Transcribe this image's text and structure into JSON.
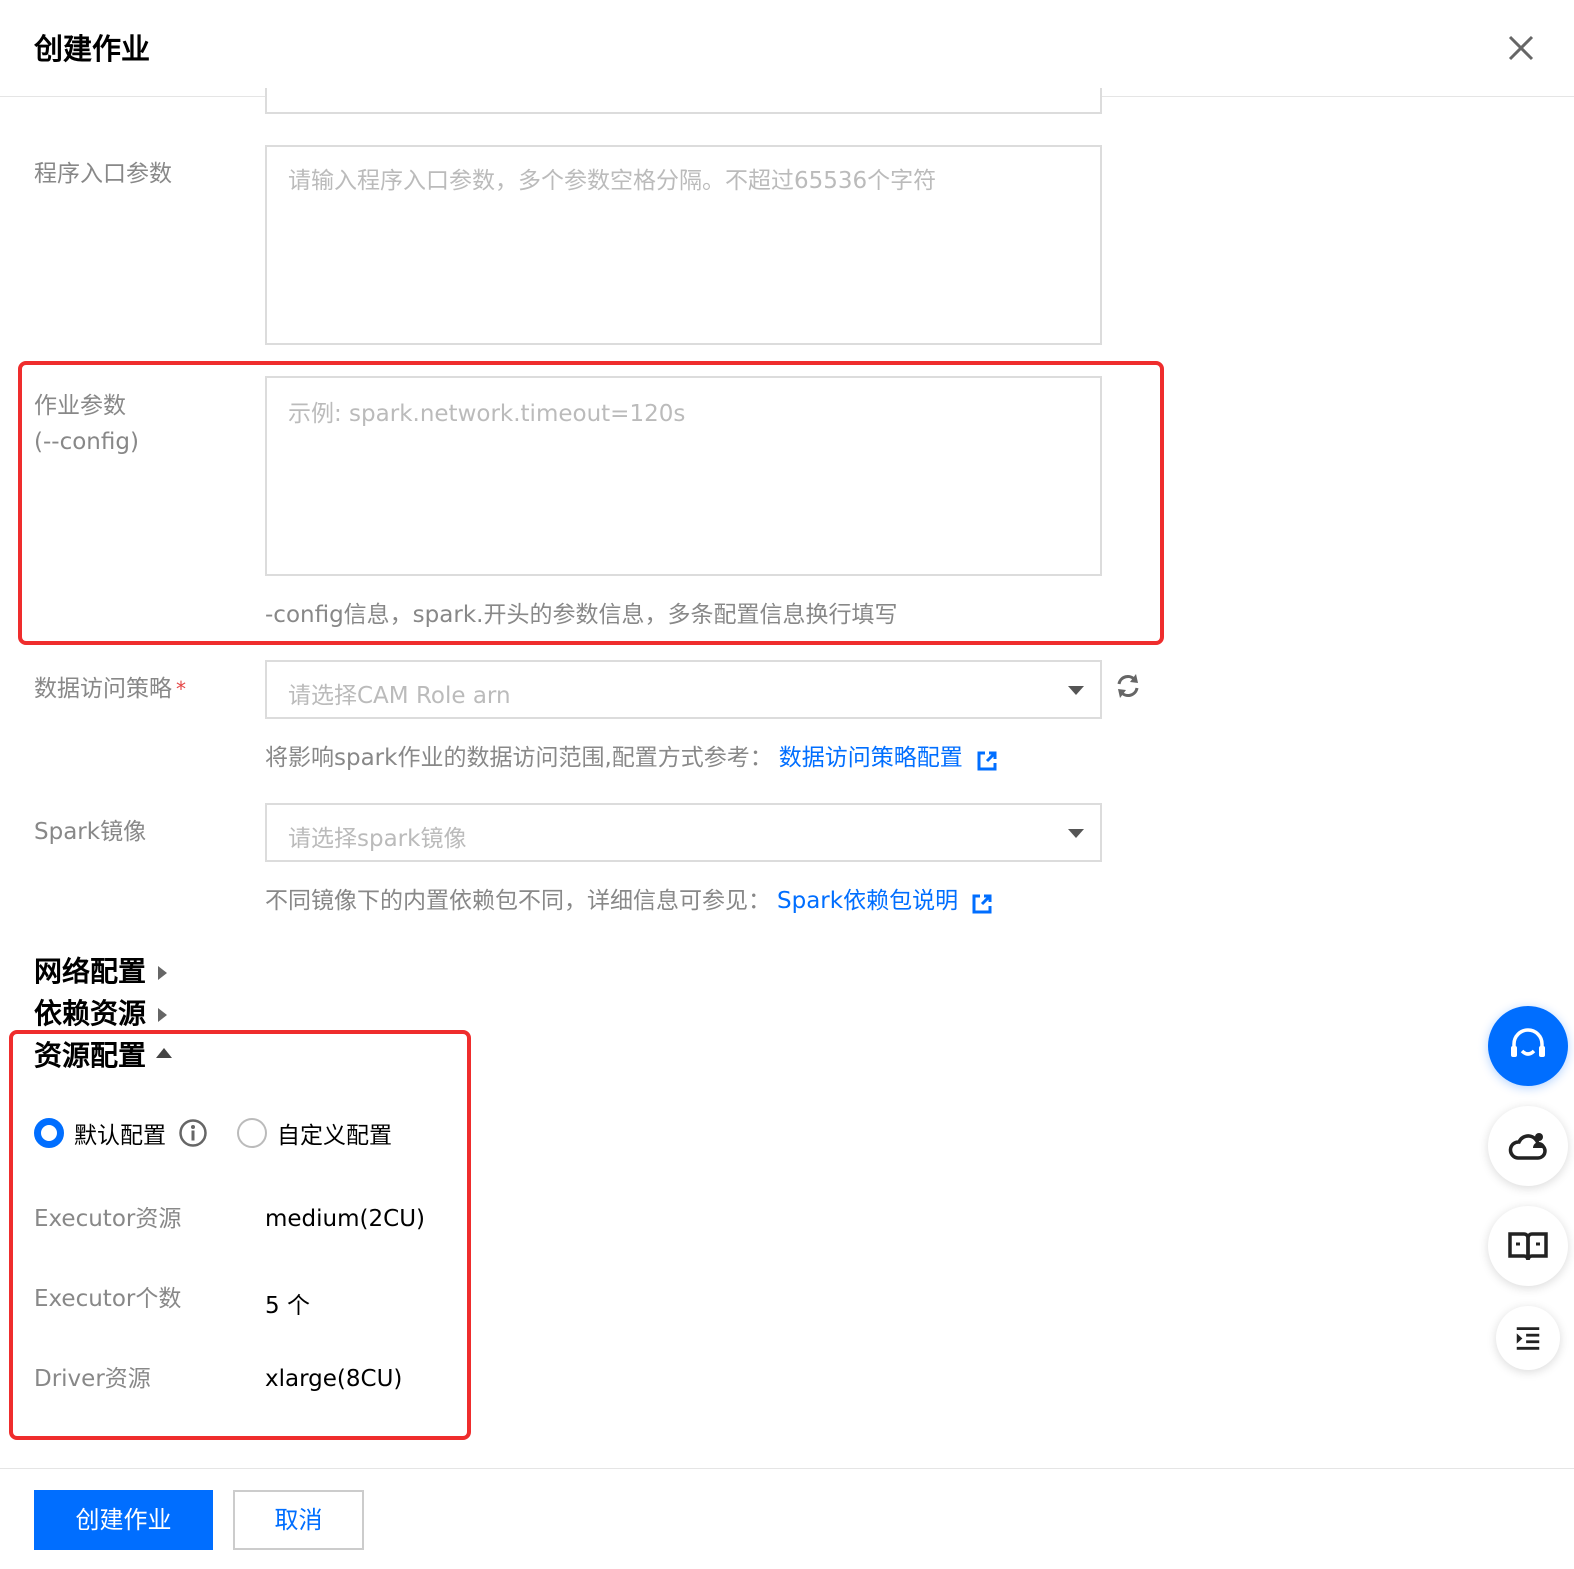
{
  "dialog": {
    "title": "创建作业",
    "close_icon": "close-icon"
  },
  "entry_params": {
    "label": "程序入口参数",
    "placeholder": "请输入程序入口参数，多个参数空格分隔。不超过65536个字符"
  },
  "job_params": {
    "label_line1": "作业参数",
    "label_line2": "(--config)",
    "placeholder": "示例: spark.network.timeout=120s",
    "hint": "-config信息，spark.开头的参数信息，多条配置信息换行填写"
  },
  "data_access": {
    "label": "数据访问策略",
    "required_mark": "*",
    "placeholder": "请选择CAM Role arn",
    "hint": "将影响spark作业的数据访问范围,配置方式参考：",
    "link": "数据访问策略配置"
  },
  "spark_image": {
    "label": "Spark镜像",
    "placeholder": "请选择spark镜像",
    "hint": "不同镜像下的内置依赖包不同，详细信息可参见：",
    "link": "Spark依赖包说明"
  },
  "sections": {
    "network": "网络配置",
    "dependencies": "依赖资源",
    "resources": "资源配置"
  },
  "resource_config": {
    "option_default": "默认配置",
    "option_custom": "自定义配置",
    "selected": "默认配置",
    "rows": [
      {
        "label": "Executor资源",
        "value": "medium(2CU)"
      },
      {
        "label": "Executor个数",
        "value": "5 个"
      },
      {
        "label": "Driver资源",
        "value": "xlarge(8CU)"
      }
    ]
  },
  "footer": {
    "create_label": "创建作业",
    "cancel_label": "取消"
  },
  "colors": {
    "primary": "#006eff",
    "highlight_border": "#ef2d2d",
    "required": "#e54545"
  }
}
